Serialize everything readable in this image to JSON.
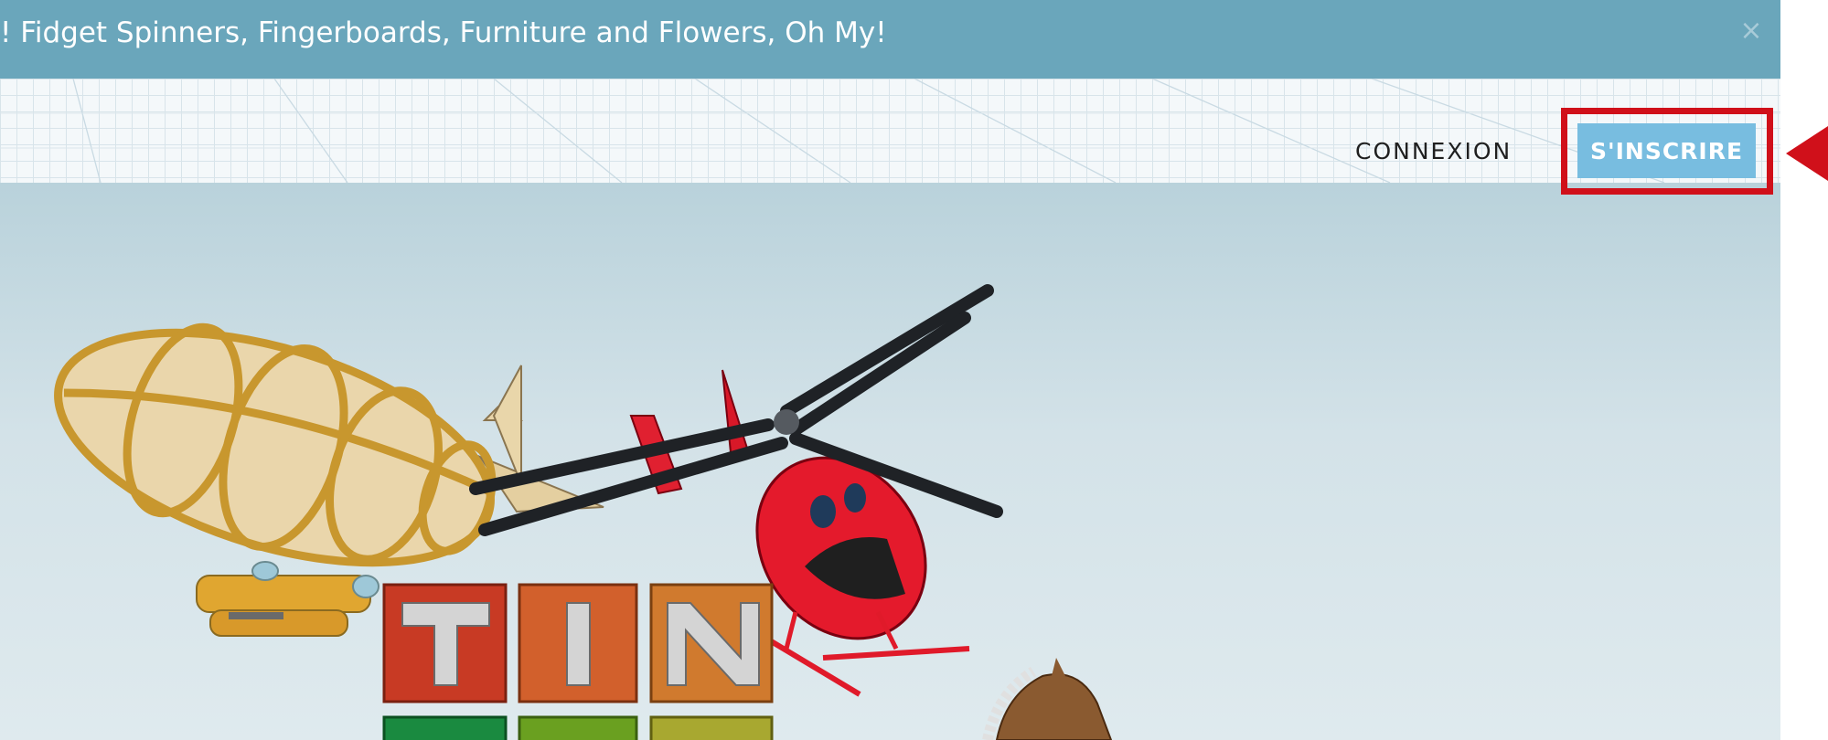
{
  "banner": {
    "message": "! Fidget Spinners, Fingerboards, Furniture and Flowers, Oh My!",
    "close_glyph": "×"
  },
  "header": {
    "login_label": "CONNEXION",
    "signup_label": "S'INSCRIRE"
  },
  "hero": {
    "block_letters": [
      "T",
      "I",
      "N"
    ]
  },
  "colors": {
    "banner_bg": "#6aa6bb",
    "signup_bg": "#78bde0",
    "highlight": "#d0101a",
    "hero_bg": "#c9dbe2"
  },
  "icons": {
    "close": "close-icon",
    "pointer": "pointer-arrow-icon"
  }
}
